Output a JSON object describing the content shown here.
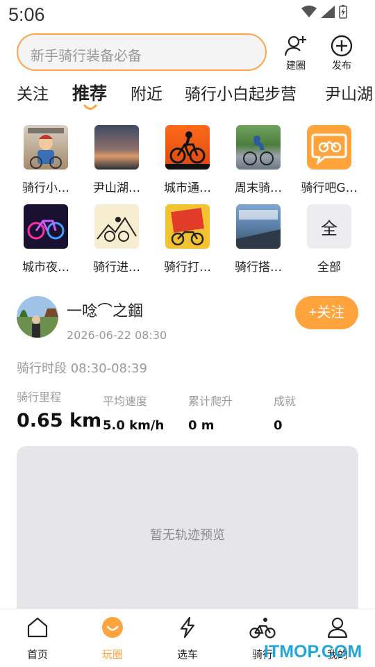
{
  "status_bar": {
    "time": "5:06"
  },
  "search": {
    "placeholder": "新手骑行装备必备"
  },
  "header_actions": {
    "create_circle": "建圈",
    "publish": "发布"
  },
  "tabs": [
    {
      "label": "关注"
    },
    {
      "label": "推荐",
      "active": true
    },
    {
      "label": "附近"
    },
    {
      "label": "骑行小白起步营"
    },
    {
      "label": "尹山湖"
    }
  ],
  "circles": [
    {
      "label": "骑行小…"
    },
    {
      "label": "尹山湖…"
    },
    {
      "label": "城市通…"
    },
    {
      "label": "周末骑…"
    },
    {
      "label": "骑行吧G…"
    },
    {
      "label": "城市夜…"
    },
    {
      "label": "骑行进…"
    },
    {
      "label": "骑行打…"
    },
    {
      "label": "骑行搭…"
    },
    {
      "label": "全部",
      "icon_text": "全"
    }
  ],
  "post": {
    "user": "一唸⌒之錮",
    "time": "2026-06-22 08:30",
    "follow_label": "+关注",
    "period": "骑行时段 08:30-08:39",
    "stats": [
      {
        "label": "骑行里程",
        "value": "0.65 km"
      },
      {
        "label": "平均速度",
        "value": "5.0 km/h"
      },
      {
        "label": "累计爬升",
        "value": "0 m"
      },
      {
        "label": "成就",
        "value": "0"
      }
    ],
    "track_empty": "暂无轨迹预览"
  },
  "bottom_nav": [
    {
      "label": "首页",
      "icon": "home-icon"
    },
    {
      "label": "玩圈",
      "icon": "circle-smile-icon",
      "active": true
    },
    {
      "label": "选车",
      "icon": "lightning-icon"
    },
    {
      "label": "骑行",
      "icon": "cyclist-icon"
    },
    {
      "label": "我的",
      "icon": "person-icon"
    }
  ],
  "watermark": "ITMOP.COM",
  "colors": {
    "accent": "#ffa33d",
    "border": "#ffa24a",
    "watermark": "#23a6d8"
  }
}
